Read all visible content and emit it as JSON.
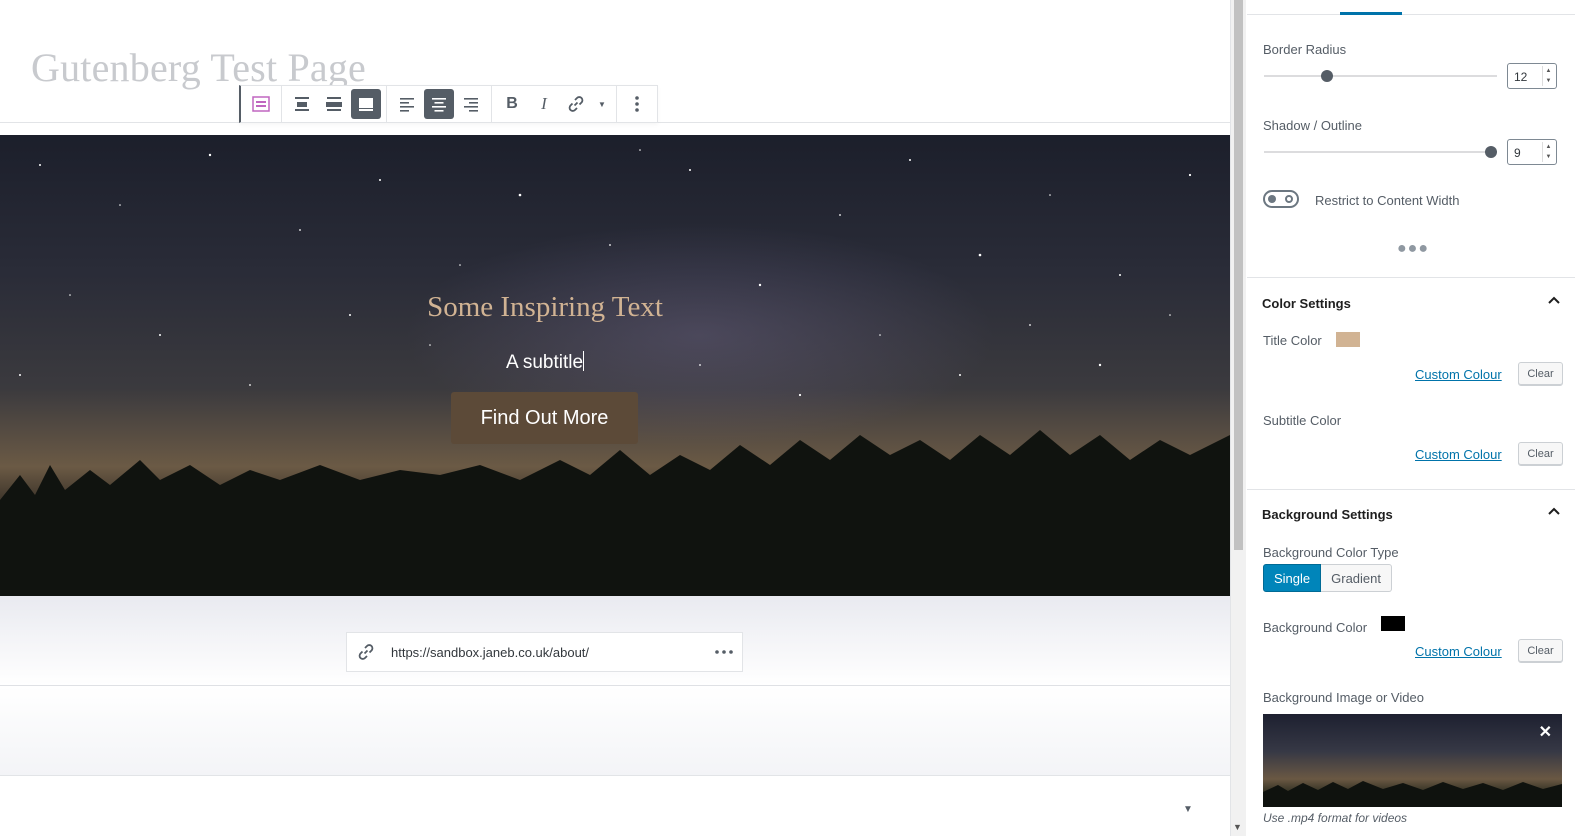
{
  "editor": {
    "page_title": "Gutenberg Test Page",
    "hero": {
      "title": "Some Inspiring Text",
      "subtitle": "A subtitle",
      "button_label": "Find Out More",
      "title_color": "#d1b393",
      "button_color": "#5c4a38"
    },
    "link_url": "https://sandbox.janeb.co.uk/about/"
  },
  "toolbar": {
    "icons": [
      "block-type-icon",
      "align-wide-icon",
      "align-full-icon",
      "align-none-icon",
      "text-align-left-icon",
      "text-align-center-icon",
      "text-align-right-icon",
      "bold-icon",
      "italic-icon",
      "link-icon",
      "more-formats-icon",
      "more-options-icon"
    ]
  },
  "sidebar": {
    "border_radius_label": "Border Radius",
    "border_radius_value": "12",
    "border_radius_level": 0.26,
    "shadow_label": "Shadow / Outline",
    "shadow_value": "9",
    "shadow_level": 1.0,
    "restrict_label": "Restrict to Content Width",
    "restrict_enabled": false,
    "color_settings": {
      "title": "Color Settings",
      "title_color_label": "Title Color",
      "title_color_swatch": "#d1b393",
      "subtitle_color_label": "Subtitle Color",
      "custom_colour": "Custom Colour",
      "clear": "Clear"
    },
    "background_settings": {
      "title": "Background Settings",
      "color_type_label": "Background Color Type",
      "type_single": "Single",
      "type_gradient": "Gradient",
      "bg_color_label": "Background Color",
      "bg_color_swatch": "#000000",
      "custom_colour": "Custom Colour",
      "clear": "Clear",
      "image_label": "Background Image or Video",
      "hint": "Use .mp4 format for videos"
    }
  },
  "colors": {
    "accent": "#0073aa",
    "toolbar_active": "#555d66"
  }
}
